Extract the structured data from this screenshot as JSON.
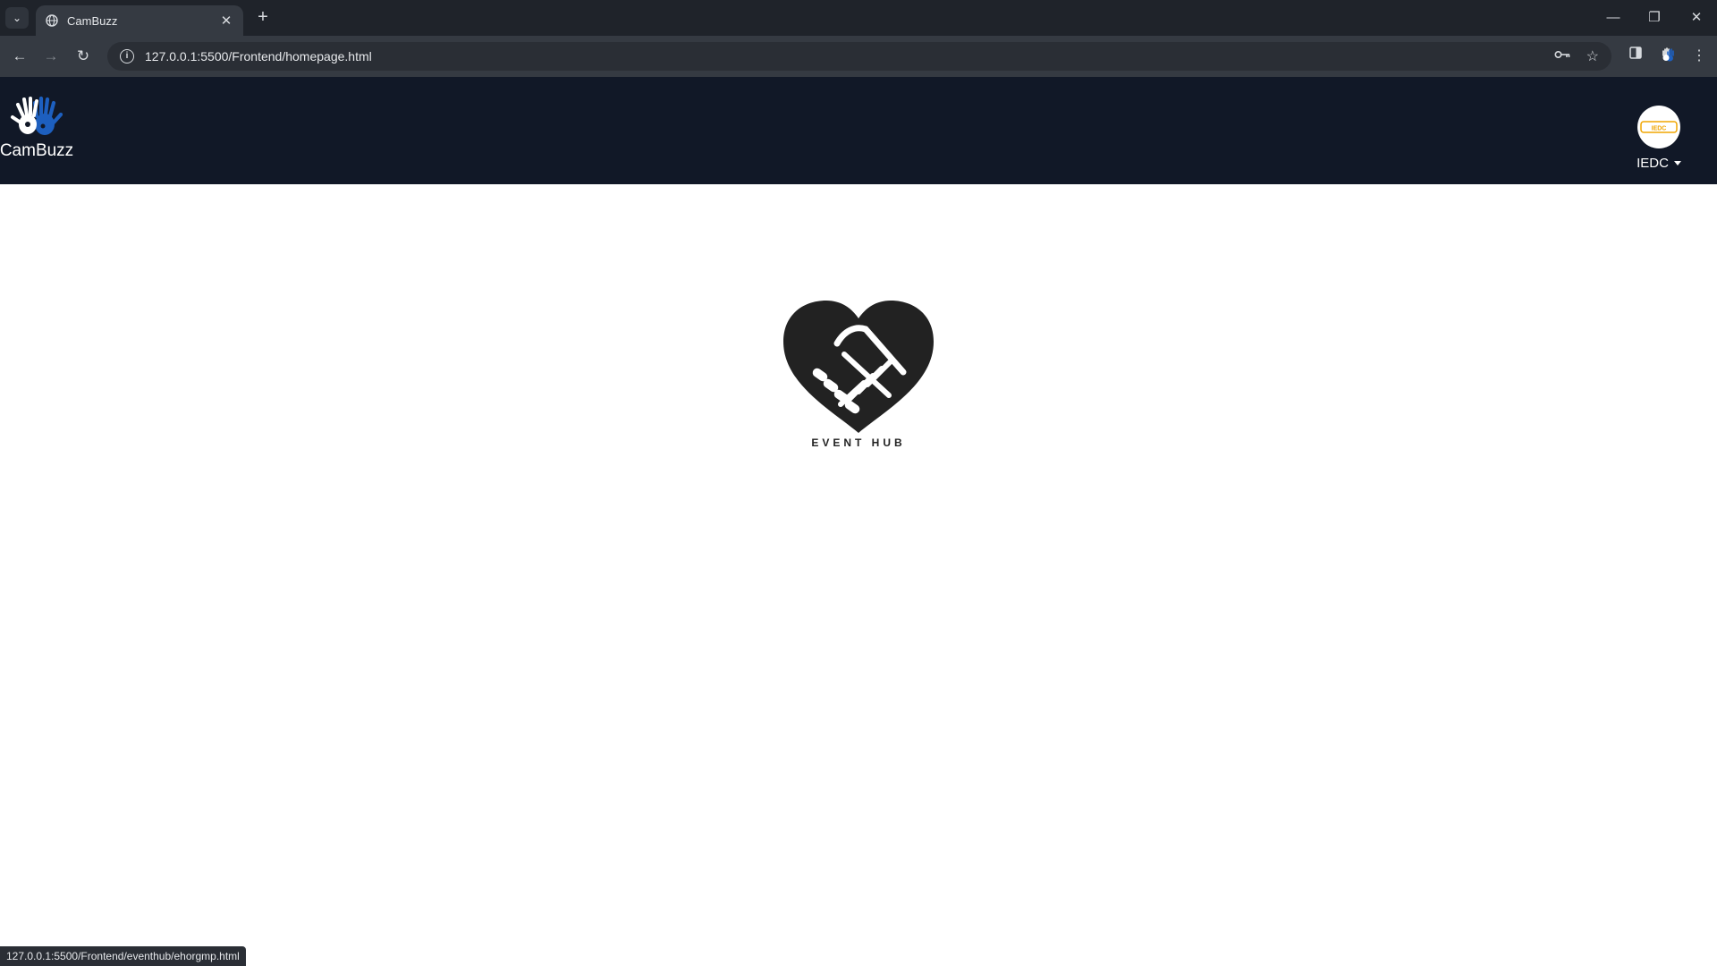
{
  "browser": {
    "tab_title": "CamBuzz",
    "new_tab_symbol": "+",
    "url": "127.0.0.1:5500/Frontend/homepage.html",
    "status_url": "127.0.0.1:5500/Frontend/eventhub/ehorgmp.html",
    "icons": [
      "tab-search-icon",
      "globe-icon",
      "close-icon",
      "new-tab-icon",
      "back-icon",
      "forward-icon",
      "reload-icon",
      "info-icon",
      "key-icon",
      "star-icon",
      "side-panel-icon",
      "extension-icon",
      "menu-icon",
      "minimize-icon",
      "restore-icon",
      "window-close-icon"
    ]
  },
  "header": {
    "brand_name": "CamBuzz",
    "account_label": "IEDC",
    "avatar_text": "IEDC",
    "background": "#111827"
  },
  "main": {
    "logo_caption": "EVENT HUB",
    "logo_color": "#222222"
  },
  "colors": {
    "brand_white": "#ffffff",
    "hand_blue": "#1d5fbf",
    "avatar_gold": "#f0a500"
  }
}
